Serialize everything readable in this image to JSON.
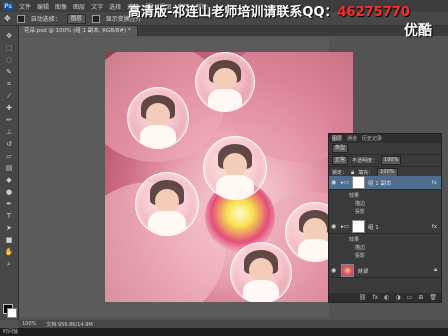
{
  "app": {
    "logo": "Ps"
  },
  "menu": [
    "文件",
    "编辑",
    "图像",
    "图层",
    "文字",
    "选择",
    "滤镜",
    "3D",
    "视图",
    "窗口",
    "帮助"
  ],
  "options": {
    "auto_select_label": "自动选择：",
    "auto_select_value": "图层",
    "transform_label": "显示变换控件"
  },
  "document": {
    "tab_title": "花朵.psd @ 100% (组 1 副本, RGB/8#) *"
  },
  "watermark": {
    "text": "高清版-祁连山老师培训请联系QQ：",
    "qq": "46275770"
  },
  "site_logo": "优酷",
  "layers_panel": {
    "tabs": [
      "图层",
      "通道",
      "历史记录"
    ],
    "filter_label": "类型",
    "blend_mode": "正常",
    "opacity_label": "不透明度：",
    "opacity_value": "100%",
    "lock_label": "锁定：",
    "fill_label": "填充：",
    "fill_value": "100%",
    "layers": [
      {
        "name": "组 1 副本",
        "effects_label": "效果",
        "effects": [
          "描边",
          "投影"
        ]
      },
      {
        "name": "组 1",
        "effects_label": "效果",
        "effects": [
          "描边",
          "投影"
        ]
      },
      {
        "name": "背景"
      }
    ],
    "bottom_icons": [
      "link-icon",
      "fx-icon",
      "mask-icon",
      "adjust-icon",
      "folder-icon",
      "new-layer-icon",
      "trash-icon"
    ]
  },
  "status": {
    "zoom": "100%",
    "doc_info": "文档:956.8K/14.9M"
  },
  "video": {
    "time": "时间轴"
  }
}
